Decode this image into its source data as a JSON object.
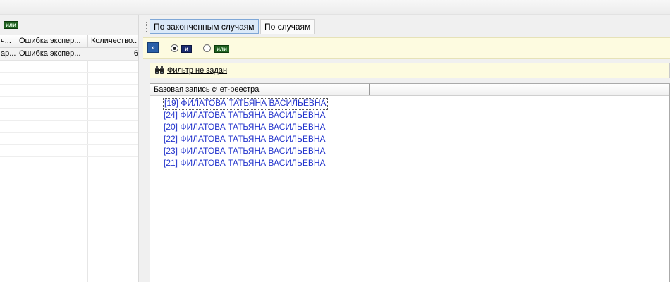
{
  "left": {
    "toolbar_badge": "или",
    "grid": {
      "columns": [
        "ч...",
        "Ошибка экспер...",
        "Количество..."
      ],
      "row": [
        "ар...",
        "Ошибка экспер...",
        "6"
      ]
    }
  },
  "right": {
    "tabs": [
      {
        "label": "По законченным случаям",
        "active": true
      },
      {
        "label": "По случаям",
        "active": false
      }
    ],
    "options": {
      "expand_icon": "double-chevron-right-icon",
      "and_label": "и",
      "or_label": "или",
      "selected": "and"
    },
    "filter": {
      "icon": "binoculars-icon",
      "label": "Фильтр не задан"
    },
    "list": {
      "column": "Базовая запись счет-реестра",
      "items": [
        "[19] ФИЛАТОВА ТАТЬЯНА ВАСИЛЬЕВНА",
        "[24] ФИЛАТОВА ТАТЬЯНА ВАСИЛЬЕВНА",
        "[20] ФИЛАТОВА ТАТЬЯНА ВАСИЛЬЕВНА",
        "[22] ФИЛАТОВА ТАТЬЯНА ВАСИЛЬЕВНА",
        "[23] ФИЛАТОВА ТАТЬЯНА ВАСИЛЬЕВНА",
        "[21] ФИЛАТОВА ТАТЬЯНА ВАСИЛЬЕВНА"
      ]
    }
  }
}
